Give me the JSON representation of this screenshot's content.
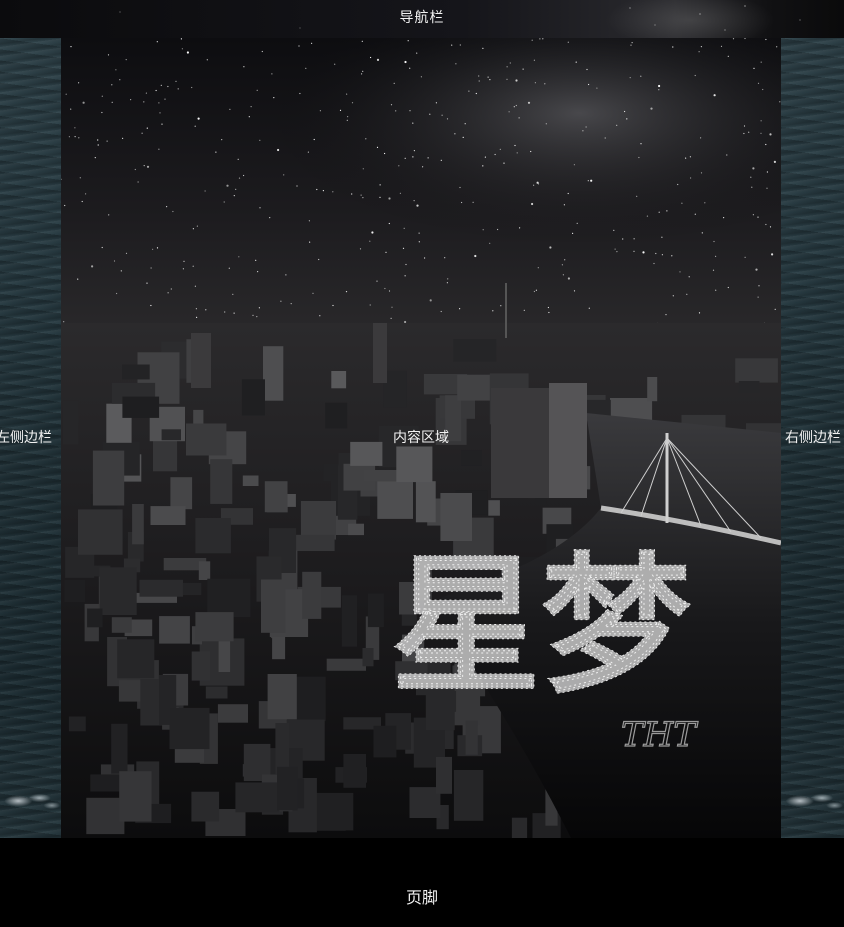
{
  "navbar": {
    "label": "导航栏"
  },
  "sidebar_left": {
    "label": "左侧边栏"
  },
  "sidebar_right": {
    "label": "右侧边栏"
  },
  "content": {
    "label": "内容区域",
    "poster": {
      "calligraphy": "星梦",
      "signature": "THT"
    }
  },
  "footer": {
    "label": "页脚"
  },
  "colors": {
    "page_background": "#000000",
    "label_text": "#f2f2f2",
    "ocean": "#25373e"
  }
}
